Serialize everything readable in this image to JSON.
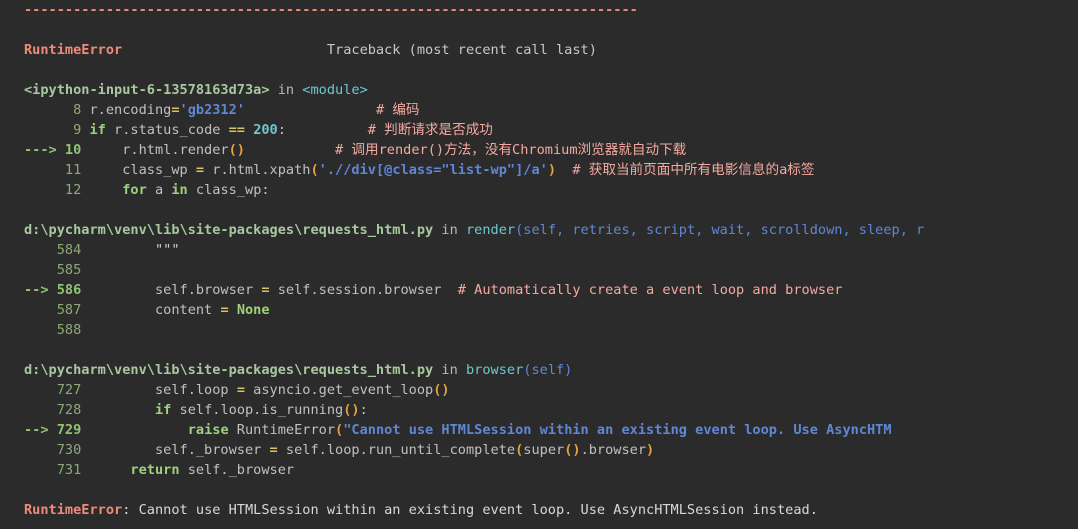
{
  "meta": {
    "background_color": "#2b2b2b",
    "default_text_color": "#d0d0d0",
    "error_color": "#f08a7a",
    "comment_color": "#f4a9a0",
    "keyword_color": "#9fd17a",
    "string_color": "#5f87d7",
    "number_color": "#6fc7cf",
    "paren_color": "#e6a23c",
    "lineno_color": "#8fa878"
  },
  "separator": "---------------------------------------------------------------------------",
  "header": {
    "exception_name": "RuntimeError",
    "traceback_label": "Traceback (most recent call last)"
  },
  "frames": [
    {
      "location_prefix": "<ipython-input-6-13578163d73a>",
      "location_in": "in",
      "location_func": "<module>",
      "lines": [
        {
          "arrow": "",
          "number": "8",
          "code": "r.encoding='gb2312'",
          "comment": "# 编码",
          "current": false
        },
        {
          "arrow": "",
          "number": "9",
          "code": "if r.status_code == 200:",
          "comment": "# 判断请求是否成功",
          "current": false
        },
        {
          "arrow": "--->",
          "number": "10",
          "code": "r.html.render()",
          "comment": "# 调用render()方法，没有Chromium浏览器就自动下载",
          "current": true
        },
        {
          "arrow": "",
          "number": "11",
          "code": "class_wp = r.html.xpath('.//div[@class=\"list-wp\"]/a')",
          "comment": "# 获取当前页面中所有电影信息的a标签",
          "current": false
        },
        {
          "arrow": "",
          "number": "12",
          "code": "for a in class_wp:",
          "comment": "",
          "current": false
        }
      ]
    },
    {
      "location_prefix": "d:\\pycharm\\venv\\lib\\site-packages\\requests_html.py",
      "location_in": "in",
      "location_func": "render",
      "location_args": "(self, retries, script, wait, scrolldown, sleep, r",
      "lines": [
        {
          "arrow": "",
          "number": "584",
          "code": "\"\"\"",
          "comment": "",
          "current": false
        },
        {
          "arrow": "",
          "number": "585",
          "code": "",
          "comment": "",
          "current": false
        },
        {
          "arrow": "-->",
          "number": "586",
          "code": "self.browser = self.session.browser",
          "comment": "# Automatically create a event loop and browser",
          "current": true
        },
        {
          "arrow": "",
          "number": "587",
          "code": "content = None",
          "comment": "",
          "current": false
        },
        {
          "arrow": "",
          "number": "588",
          "code": "",
          "comment": "",
          "current": false
        }
      ]
    },
    {
      "location_prefix": "d:\\pycharm\\venv\\lib\\site-packages\\requests_html.py",
      "location_in": "in",
      "location_func": "browser",
      "location_args": "(self)",
      "lines": [
        {
          "arrow": "",
          "number": "727",
          "code": "self.loop = asyncio.get_event_loop()",
          "comment": "",
          "current": false
        },
        {
          "arrow": "",
          "number": "728",
          "code": "if self.loop.is_running():",
          "comment": "",
          "current": false
        },
        {
          "arrow": "-->",
          "number": "729",
          "code": "raise RuntimeError(\"Cannot use HTMLSession within an existing event loop. Use AsyncHTM",
          "comment": "",
          "current": true
        },
        {
          "arrow": "",
          "number": "730",
          "code": "self._browser = self.loop.run_until_complete(super().browser)",
          "comment": "",
          "current": false
        },
        {
          "arrow": "",
          "number": "731",
          "code": "return self._browser",
          "comment": "",
          "current": false
        }
      ]
    }
  ],
  "final_error": {
    "name": "RuntimeError",
    "separator": ": ",
    "message": "Cannot use HTMLSession within an existing event loop. Use AsyncHTMLSession instead."
  }
}
